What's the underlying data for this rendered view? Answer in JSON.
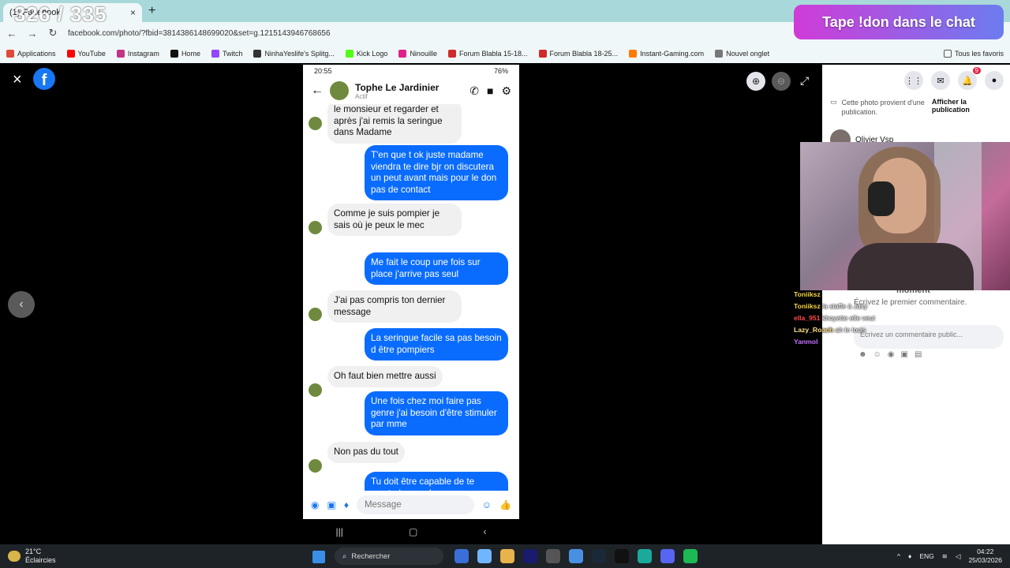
{
  "browser": {
    "tab_title": "(1) Facebook",
    "new_tab": "+",
    "url": "facebook.com/photo/?fbid=381438614869902​0&set=g.1215143946768656",
    "stream_counter": "326 / 335"
  },
  "bookmarks": [
    {
      "label": "Applications",
      "color": "#e04a3a"
    },
    {
      "label": "YouTube",
      "color": "#ff0000"
    },
    {
      "label": "Instagram",
      "color": "#c13584"
    },
    {
      "label": "Home",
      "color": "#111111"
    },
    {
      "label": "Twitch",
      "color": "#9146ff"
    },
    {
      "label": "NinhaYeslife's Splitg...",
      "color": "#333333"
    },
    {
      "label": "Kick Logo",
      "color": "#53fc18"
    },
    {
      "label": "Ninouille",
      "color": "#e0208a"
    },
    {
      "label": "Forum Blabla 15-18...",
      "color": "#d02a2a"
    },
    {
      "label": "Forum Blabla 18-25...",
      "color": "#d02a2a"
    },
    {
      "label": "Instant-Gaming.com",
      "color": "#ff7a00"
    },
    {
      "label": "Nouvel onglet",
      "color": "#777777"
    }
  ],
  "bookmarks_right": "Tous les favoris",
  "viewer": {
    "close_icon": "×",
    "logo": "f",
    "prev_icon": "‹"
  },
  "phone": {
    "time": "20:55",
    "battery": "76%",
    "contact_name": "Tophe Le Jardinier",
    "contact_status": "Actif",
    "composer_placeholder": "Message",
    "messages": [
      {
        "side": "in",
        "text": "le monsieur et regarder et après j'ai remis la seringue dans Madame"
      },
      {
        "side": "out",
        "text": "T'en que t ok juste madame viendra te dire bjr on discutera un peut avant mais pour le don pas de contact"
      },
      {
        "side": "in",
        "text": "Comme je suis pompier je sais où je peux le mec"
      },
      {
        "side": "out",
        "text": "Me fait le coup une fois sur place j'arrive pas seul"
      },
      {
        "side": "in",
        "text": "J'ai pas compris ton dernier message"
      },
      {
        "side": "out",
        "text": "La seringue facile sa pas besoin d être pompiers"
      },
      {
        "side": "in",
        "text": "Oh faut bien mettre aussi"
      },
      {
        "side": "out",
        "text": "Une fois chez moi faire pas genre j'ai besoin d'être stimuler par mme"
      },
      {
        "side": "in",
        "text": "Non pas du tout"
      },
      {
        "side": "out",
        "text": "Tu doit être capable de te masturber seul"
      }
    ]
  },
  "sidebar": {
    "notif_count": "9",
    "source_text": "Cette photo provient d'une publication.",
    "source_link": "Afficher la publication",
    "author": "Olivier Vsp",
    "time_label": "moment",
    "first_comment": "Écrivez le premier commentaire.",
    "comment_placeholder": "Écrivez un commentaire public..."
  },
  "banner_text": "Tape !don dans le chat",
  "stream_chat": [
    {
      "user": "Toniiksz",
      "text": "",
      "color": "#f5d442"
    },
    {
      "user": "Toniiksz",
      "text": "la staffe à Jaxy",
      "color": "#f5d442"
    },
    {
      "user": "ella_951",
      "text": "khoyette elle veut",
      "color": "#ff4a4a"
    },
    {
      "user": "Lazy_Roach",
      "text": "ah le louis",
      "color": "#ffe08a"
    },
    {
      "user": "Yanmol",
      "text": "",
      "color": "#c070ff"
    }
  ],
  "taskbar": {
    "temperature": "21°C",
    "weather": "Éclaircies",
    "search_label": "Rechercher",
    "language": "ENG",
    "time": "04:22",
    "date": "25/03/2026",
    "apps": [
      "#3a6fd8",
      "#6fb6ff",
      "#e8b34a",
      "#1a1a6e",
      "#555555",
      "#4a90e2",
      "#1b2838",
      "#111111",
      "#1aa99a",
      "#5865f2",
      "#1db954"
    ]
  }
}
